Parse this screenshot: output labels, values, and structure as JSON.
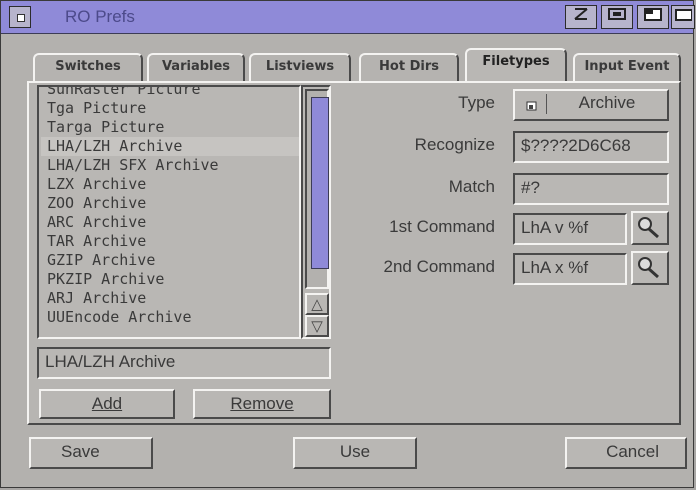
{
  "window": {
    "title": "RO Prefs"
  },
  "tabs": [
    {
      "label": "Switches"
    },
    {
      "label": "Variables"
    },
    {
      "label": "Listviews"
    },
    {
      "label": "Hot Dirs"
    },
    {
      "label": "Filetypes"
    },
    {
      "label": "Input Event"
    }
  ],
  "filetypes": {
    "items": [
      "SunRaster Picture",
      "Tga Picture",
      "Targa Picture",
      "LHA/LZH Archive",
      "LHA/LZH SFX Archive",
      "LZX Archive",
      "ZOO Archive",
      "ARC Archive",
      "TAR Archive",
      "GZIP Archive",
      "PKZIP Archive",
      "ARJ Archive",
      "UUEncode Archive"
    ],
    "selected_index": 3,
    "selected_name": "LHA/LZH Archive",
    "add_label": "Add",
    "remove_label": "Remove",
    "type_label": "Type",
    "type_value": "Archive",
    "recognize_label": "Recognize",
    "recognize_value": "$????2D6C68",
    "match_label": "Match",
    "match_value": "#?",
    "cmd1_label": "1st Command",
    "cmd1_value": "LhA v %f",
    "cmd2_label": "2nd Command",
    "cmd2_value": "LhA x %f"
  },
  "buttons": {
    "save": "Save",
    "use": "Use",
    "cancel": "Cancel"
  },
  "colors": {
    "titlebar": "#8f8ad8",
    "background": "#b3b1ae",
    "scroll_knob": "#8f8ad8"
  },
  "icons": [
    "close-gadget-icon",
    "depth-gadget-icon",
    "zoom-gadget-icon",
    "iconify-gadget-icon",
    "cycle-icon",
    "magnifier-icon",
    "arrow-up-icon",
    "arrow-down-icon"
  ]
}
